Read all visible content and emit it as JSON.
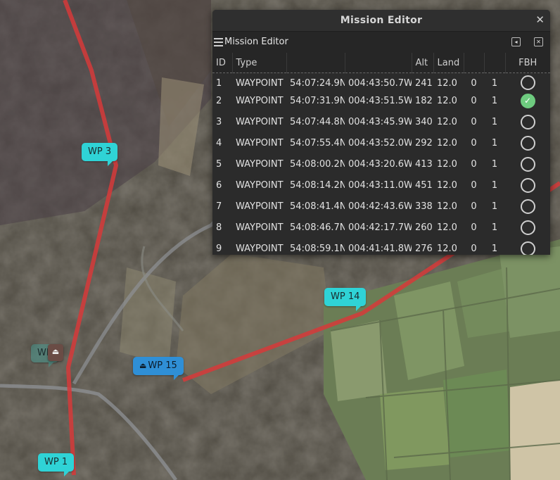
{
  "map": {
    "waypoints": [
      {
        "label": "WP 3",
        "kind": "waypoint"
      },
      {
        "label": "WP 14",
        "kind": "waypoint"
      },
      {
        "label": "WP 15",
        "kind": "home"
      },
      {
        "label": "WP 1",
        "kind": "waypoint"
      },
      {
        "label": "WP",
        "kind": "ghost"
      }
    ],
    "home_glyph": "⏏",
    "route_color": "#d63a3a"
  },
  "window": {
    "title": "Mission Editor",
    "close_glyph": "✕",
    "dock_title": "Mission Editor",
    "float_glyph": "◂",
    "dock_close_glyph": "✕"
  },
  "table": {
    "headers": [
      "ID",
      "Type",
      "",
      "",
      "Alt",
      "Land",
      "",
      "",
      "FBH"
    ],
    "rows": [
      {
        "id": "1",
        "type": "WAYPOINT",
        "lat": "54:07:24.9N",
        "lon": "004:43:50.7W",
        "alt": "241",
        "land": "12.0",
        "c7": "0",
        "c8": "1",
        "fbh": false
      },
      {
        "id": "2",
        "type": "WAYPOINT",
        "lat": "54:07:31.9N",
        "lon": "004:43:51.5W",
        "alt": "182",
        "land": "12.0",
        "c7": "0",
        "c8": "1",
        "fbh": true
      },
      {
        "id": "3",
        "type": "WAYPOINT",
        "lat": "54:07:44.8N",
        "lon": "004:43:45.9W",
        "alt": "340",
        "land": "12.0",
        "c7": "0",
        "c8": "1",
        "fbh": false
      },
      {
        "id": "4",
        "type": "WAYPOINT",
        "lat": "54:07:55.4N",
        "lon": "004:43:52.0W",
        "alt": "292",
        "land": "12.0",
        "c7": "0",
        "c8": "1",
        "fbh": false
      },
      {
        "id": "5",
        "type": "WAYPOINT",
        "lat": "54:08:00.2N",
        "lon": "004:43:20.6W",
        "alt": "413",
        "land": "12.0",
        "c7": "0",
        "c8": "1",
        "fbh": false
      },
      {
        "id": "6",
        "type": "WAYPOINT",
        "lat": "54:08:14.2N",
        "lon": "004:43:11.0W",
        "alt": "451",
        "land": "12.0",
        "c7": "0",
        "c8": "1",
        "fbh": false
      },
      {
        "id": "7",
        "type": "WAYPOINT",
        "lat": "54:08:41.4N",
        "lon": "004:42:43.6W",
        "alt": "338",
        "land": "12.0",
        "c7": "0",
        "c8": "1",
        "fbh": false
      },
      {
        "id": "8",
        "type": "WAYPOINT",
        "lat": "54:08:46.7N",
        "lon": "004:42:17.7W",
        "alt": "260",
        "land": "12.0",
        "c7": "0",
        "c8": "1",
        "fbh": false
      },
      {
        "id": "9",
        "type": "WAYPOINT",
        "lat": "54:08:59.1N",
        "lon": "004:41:41.8W",
        "alt": "276",
        "land": "12.0",
        "c7": "0",
        "c8": "1",
        "fbh": false
      }
    ]
  }
}
